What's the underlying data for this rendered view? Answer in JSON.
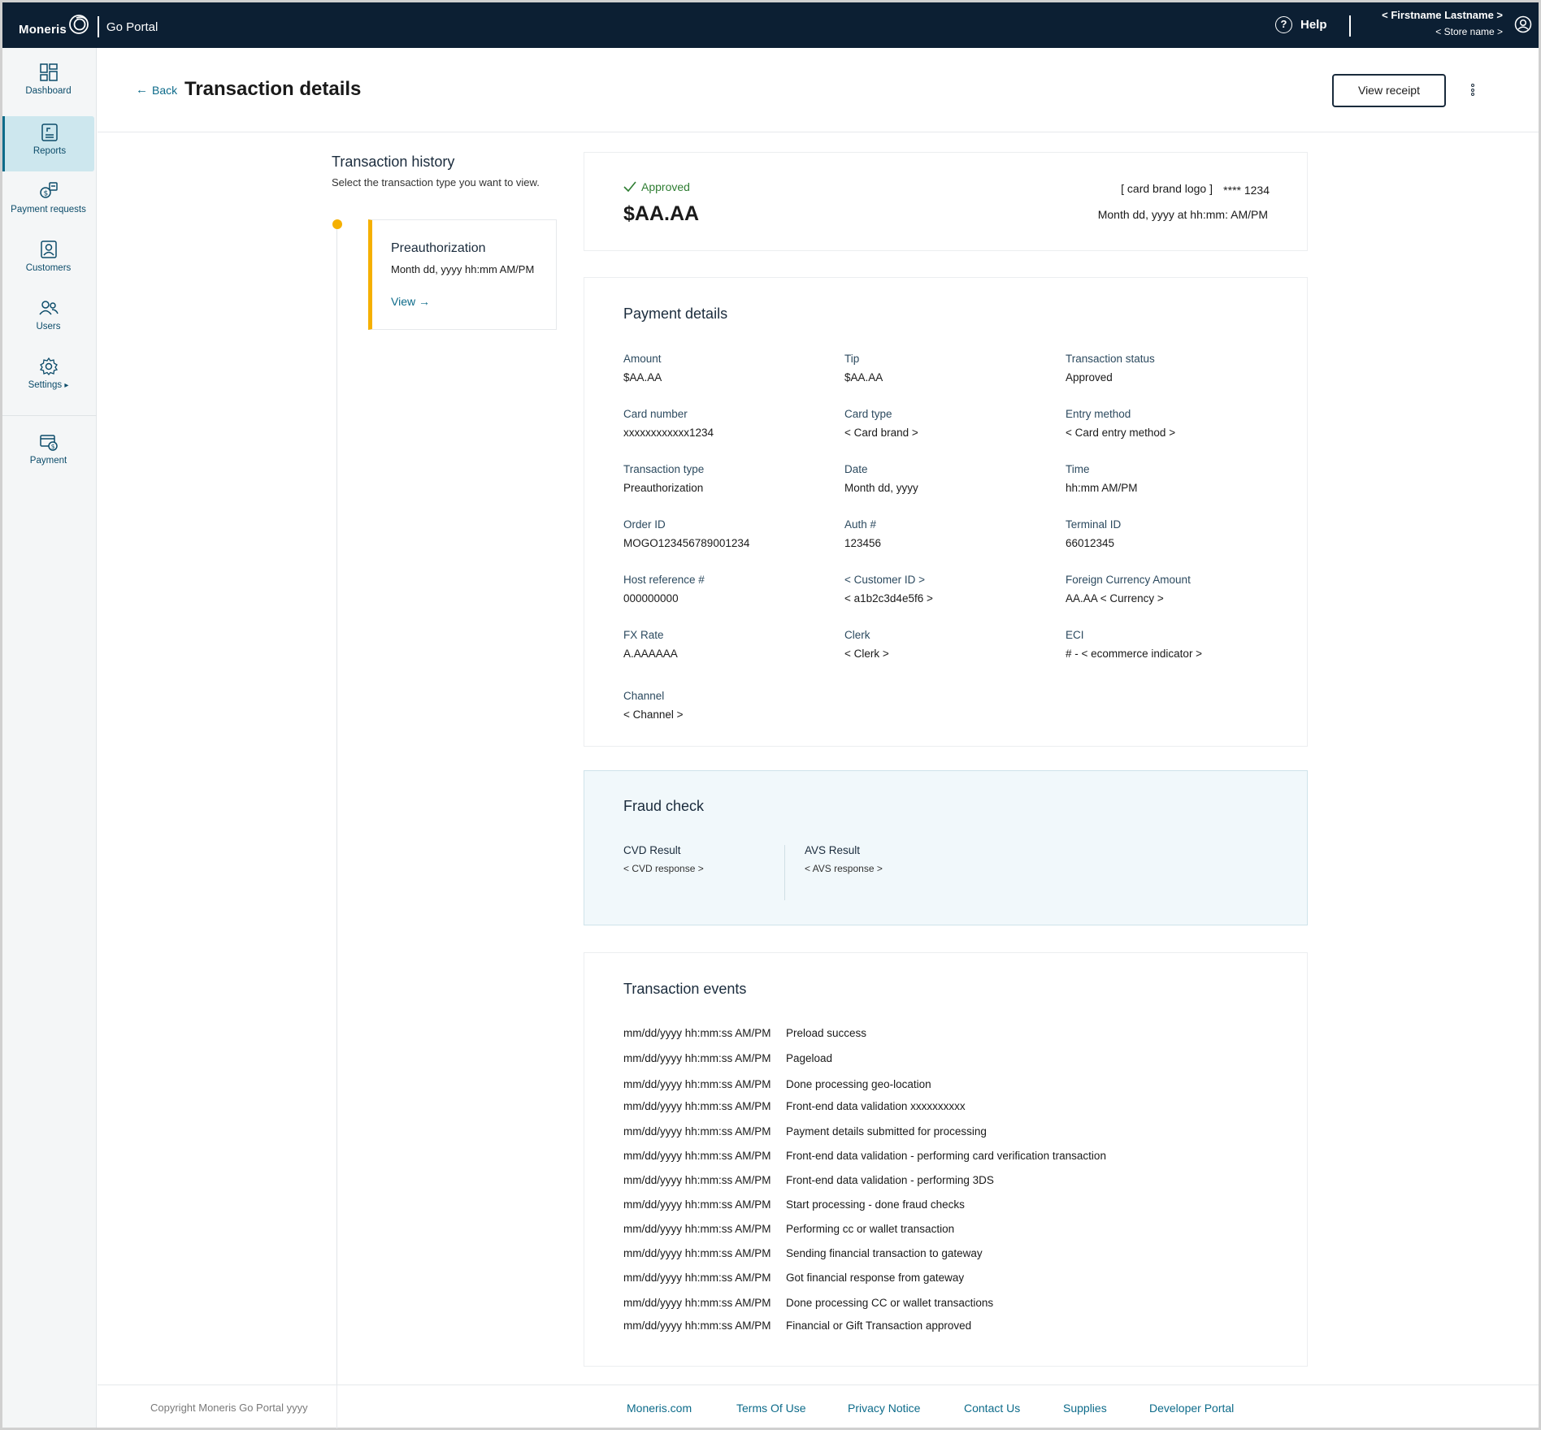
{
  "topbar": {
    "brand": "Moneris",
    "portal": "Go Portal",
    "help": "Help",
    "help_icon": "?",
    "user_name": "< Firstname Lastname >",
    "store_name": "< Store name >"
  },
  "sidebar": {
    "items": [
      {
        "label": "Dashboard",
        "icon": "dashboard-icon"
      },
      {
        "label": "Reports",
        "icon": "reports-icon",
        "active": true
      },
      {
        "label": "Payment requests",
        "icon": "payment-requests-icon"
      },
      {
        "label": "Customers",
        "icon": "customers-icon"
      },
      {
        "label": "Users",
        "icon": "users-icon"
      },
      {
        "label": "Settings",
        "icon": "settings-icon"
      },
      {
        "label": "Payment",
        "icon": "payment-icon"
      }
    ]
  },
  "header": {
    "back_label": "Back",
    "title": "Transaction details",
    "view_receipt": "View receipt"
  },
  "history": {
    "title": "Transaction history",
    "subtitle": "Select the transaction type you want to view.",
    "card": {
      "type": "Preauthorization",
      "date": "Month dd, yyyy hh:mm AM/PM",
      "view": "View"
    }
  },
  "summary": {
    "status": "Approved",
    "amount": "$AA.AA",
    "card_brand_logo": "[ card brand logo ]",
    "masked_card": "**** 1234",
    "datetime": "Month dd, yyyy at hh:mm: AM/PM"
  },
  "payment_details": {
    "title": "Payment details",
    "fields": [
      {
        "label": "Amount",
        "value": "$AA.AA"
      },
      {
        "label": "Tip",
        "value": "$AA.AA"
      },
      {
        "label": "Transaction status",
        "value": "Approved"
      },
      {
        "label": "Card number",
        "value": "xxxxxxxxxxxx1234"
      },
      {
        "label": "Card type",
        "value": "< Card brand >"
      },
      {
        "label": "Entry method",
        "value": "< Card entry method >"
      },
      {
        "label": "Transaction type",
        "value": "Preauthorization"
      },
      {
        "label": "Date",
        "value": "Month dd, yyyy"
      },
      {
        "label": "Time",
        "value": "hh:mm AM/PM"
      },
      {
        "label": "Order ID",
        "value": "MOGO123456789001234"
      },
      {
        "label": "Auth #",
        "value": "123456"
      },
      {
        "label": "Terminal ID",
        "value": "66012345"
      },
      {
        "label": "Host reference #",
        "value": "000000000"
      },
      {
        "label": "< Customer ID >",
        "value": "< a1b2c3d4e5f6 >"
      },
      {
        "label": "Foreign Currency Amount",
        "value": "AA.AA < Currency >"
      },
      {
        "label": "FX Rate",
        "value": "A.AAAAAA"
      },
      {
        "label": "Clerk",
        "value": "< Clerk >"
      },
      {
        "label": "ECI",
        "value": "# - < ecommerce indicator >"
      },
      {
        "label": "Channel",
        "value": "< Channel >"
      }
    ]
  },
  "fraud_check": {
    "title": "Fraud check",
    "cvd_label": "CVD Result",
    "cvd_value": "< CVD response >",
    "avs_label": "AVS Result",
    "avs_value": "< AVS response >"
  },
  "transaction_events": {
    "title": "Transaction events",
    "events": [
      {
        "ts": "mm/dd/yyyy hh:mm:ss AM/PM",
        "desc": "Preload success"
      },
      {
        "ts": "mm/dd/yyyy hh:mm:ss AM/PM",
        "desc": "Pageload"
      },
      {
        "ts": "mm/dd/yyyy hh:mm:ss AM/PM",
        "desc": "Done processing geo-location"
      },
      {
        "ts": "mm/dd/yyyy hh:mm:ss AM/PM",
        "desc": "Front-end data validation xxxxxxxxxx"
      },
      {
        "ts": "mm/dd/yyyy hh:mm:ss AM/PM",
        "desc": "Payment details submitted for processing"
      },
      {
        "ts": "mm/dd/yyyy hh:mm:ss AM/PM",
        "desc": "Front-end data validation - performing card verification transaction"
      },
      {
        "ts": "mm/dd/yyyy hh:mm:ss AM/PM",
        "desc": "Front-end data validation - performing 3DS"
      },
      {
        "ts": "mm/dd/yyyy hh:mm:ss AM/PM",
        "desc": "Start processing - done fraud checks"
      },
      {
        "ts": "mm/dd/yyyy hh:mm:ss AM/PM",
        "desc": "Performing cc or wallet transaction"
      },
      {
        "ts": "mm/dd/yyyy hh:mm:ss AM/PM",
        "desc": "Sending financial transaction to gateway"
      },
      {
        "ts": "mm/dd/yyyy hh:mm:ss AM/PM",
        "desc": "Got financial response from gateway"
      },
      {
        "ts": "mm/dd/yyyy hh:mm:ss AM/PM",
        "desc": "Done processing CC or wallet transactions"
      },
      {
        "ts": "mm/dd/yyyy hh:mm:ss AM/PM",
        "desc": "Financial or Gift Transaction approved"
      }
    ]
  },
  "footer": {
    "copyright": "Copyright Moneris Go Portal  yyyy",
    "links": [
      "Moneris.com",
      "Terms Of Use",
      "Privacy Notice",
      "Contact Us",
      "Supplies",
      "Developer Portal"
    ]
  },
  "colors": {
    "topbar": "#0c1f33",
    "accent": "#0d6b8a",
    "highlight": "#f5b000",
    "approved": "#2e7d32",
    "fraud_bg": "#f1f8fb"
  }
}
